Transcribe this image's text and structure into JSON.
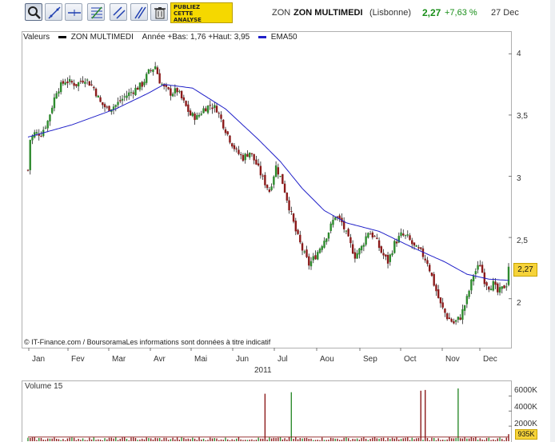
{
  "toolbar": {
    "buttons": [
      {
        "name": "zoom-tool-button",
        "icon": "magnifier-icon"
      },
      {
        "name": "trendline-tool-button",
        "icon": "trendline-icon"
      },
      {
        "name": "horizontal-line-tool-button",
        "icon": "horizontal-line-icon"
      },
      {
        "name": "fibonacci-tool-button",
        "icon": "fibonacci-icon"
      },
      {
        "name": "channel-tool-button",
        "icon": "channel-icon"
      },
      {
        "name": "parallel-lines-tool-button",
        "icon": "parallel-lines-icon"
      },
      {
        "name": "delete-drawings-button",
        "icon": "trash-icon"
      }
    ],
    "promo_line1": "PUBLIEZ",
    "promo_line2": "CETTE",
    "promo_line3": "ANALYSE"
  },
  "header": {
    "ticker": "ZON",
    "name": "ZON MULTIMEDI",
    "exchange": "(Lisbonne)",
    "price": "2,27",
    "change": "+7,63 %",
    "date": "27 Dec",
    "price_color": "#1a8f1a"
  },
  "legend": {
    "valeurs": "Valeurs",
    "series_name": "ZON MULTIMEDI",
    "range_text": "Année +Bas: 1,76 +Haut: 3,95",
    "ema_name": "EMA50",
    "series_color": "#000000",
    "ema_color": "#1f1fc8"
  },
  "source_note": "© IT-Finance.com / BoursoramaLes informations sont données à titre indicatif",
  "last_price_flag": "2,27",
  "volume_label": "Volume 15",
  "volume_flag": "935K",
  "chart_data": [
    {
      "type": "candlestick",
      "title": "",
      "x_tick_labels": [
        "Jan",
        "Fev",
        "Mar",
        "Avr",
        "Mai",
        "Jun",
        "Jul",
        "Aou",
        "Sep",
        "Oct",
        "Nov",
        "Dec"
      ],
      "x_year_label": "2011",
      "y_tick_labels": [
        "2",
        "2,5",
        "3",
        "3,5",
        "4"
      ],
      "ylim": [
        1.6,
        4.1
      ],
      "grid": false,
      "legend_position": "top-left",
      "up_color": "#2e8b2e",
      "down_color": "#8b1a1a",
      "anchors": [
        [
          0,
          3.05
        ],
        [
          1,
          3.3
        ],
        [
          3,
          3.35
        ],
        [
          6,
          3.35
        ],
        [
          9,
          3.45
        ],
        [
          13,
          3.7
        ],
        [
          17,
          3.78
        ],
        [
          22,
          3.75
        ],
        [
          26,
          3.8
        ],
        [
          30,
          3.72
        ],
        [
          33,
          3.6
        ],
        [
          36,
          3.55
        ],
        [
          40,
          3.58
        ],
        [
          44,
          3.65
        ],
        [
          48,
          3.7
        ],
        [
          52,
          3.75
        ],
        [
          55,
          3.85
        ],
        [
          58,
          3.9
        ],
        [
          60,
          3.78
        ],
        [
          62,
          3.72
        ],
        [
          65,
          3.68
        ],
        [
          68,
          3.7
        ],
        [
          71,
          3.6
        ],
        [
          74,
          3.5
        ],
        [
          77,
          3.48
        ],
        [
          80,
          3.55
        ],
        [
          83,
          3.58
        ],
        [
          86,
          3.55
        ],
        [
          89,
          3.42
        ],
        [
          92,
          3.3
        ],
        [
          95,
          3.2
        ],
        [
          98,
          3.15
        ],
        [
          101,
          3.2
        ],
        [
          104,
          3.1
        ],
        [
          107,
          2.98
        ],
        [
          110,
          2.88
        ],
        [
          113,
          3.08
        ],
        [
          116,
          2.95
        ],
        [
          119,
          2.75
        ],
        [
          122,
          2.55
        ],
        [
          125,
          2.4
        ],
        [
          128,
          2.28
        ],
        [
          131,
          2.35
        ],
        [
          134,
          2.45
        ],
        [
          137,
          2.55
        ],
        [
          140,
          2.68
        ],
        [
          143,
          2.62
        ],
        [
          146,
          2.48
        ],
        [
          149,
          2.35
        ],
        [
          152,
          2.42
        ],
        [
          155,
          2.55
        ],
        [
          158,
          2.5
        ],
        [
          161,
          2.38
        ],
        [
          164,
          2.3
        ],
        [
          167,
          2.45
        ],
        [
          170,
          2.52
        ],
        [
          173,
          2.5
        ],
        [
          176,
          2.42
        ],
        [
          179,
          2.38
        ],
        [
          182,
          2.3
        ],
        [
          185,
          2.12
        ],
        [
          188,
          1.95
        ],
        [
          191,
          1.85
        ],
        [
          194,
          1.8
        ],
        [
          197,
          1.85
        ],
        [
          200,
          2.0
        ],
        [
          203,
          2.2
        ],
        [
          206,
          2.28
        ],
        [
          208,
          2.15
        ],
        [
          210,
          2.1
        ],
        [
          212,
          2.12
        ],
        [
          214,
          2.05
        ],
        [
          216,
          2.08
        ],
        [
          218,
          2.12
        ],
        [
          219,
          2.27
        ]
      ],
      "ema50_anchors": [
        [
          0,
          3.32
        ],
        [
          20,
          3.42
        ],
        [
          40,
          3.55
        ],
        [
          55,
          3.68
        ],
        [
          62,
          3.75
        ],
        [
          75,
          3.72
        ],
        [
          90,
          3.55
        ],
        [
          105,
          3.3
        ],
        [
          115,
          3.12
        ],
        [
          125,
          2.9
        ],
        [
          135,
          2.72
        ],
        [
          145,
          2.62
        ],
        [
          160,
          2.55
        ],
        [
          175,
          2.42
        ],
        [
          190,
          2.3
        ],
        [
          200,
          2.2
        ],
        [
          210,
          2.16
        ],
        [
          219,
          2.15
        ]
      ]
    },
    {
      "type": "bar",
      "title": "Volume 15",
      "y_tick_labels": [
        "2000K",
        "4000K",
        "6000K"
      ],
      "ylim": [
        0,
        7000
      ],
      "grid": false,
      "color": "#8b1a1a",
      "baseline": 300,
      "ma15_level": 550,
      "spikes": [
        [
          108,
          6300
        ],
        [
          120,
          6500
        ],
        [
          179,
          6700
        ],
        [
          181,
          6800
        ],
        [
          196,
          7000
        ],
        [
          219,
          935
        ]
      ]
    }
  ]
}
